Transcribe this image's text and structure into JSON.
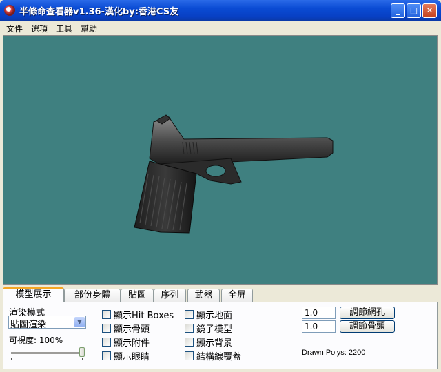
{
  "window": {
    "title": "半條命查看器v1.36-漢化by:香港CS友"
  },
  "menu": [
    "文件",
    "選項",
    "工具",
    "幫助"
  ],
  "tabs": [
    "模型展示",
    "部份身體",
    "貼圖",
    "序列",
    "武器",
    "全屏"
  ],
  "render_mode": {
    "label": "渲染模式",
    "value": "貼圖渲染"
  },
  "visibility": {
    "label": "可視度: 100%",
    "level_percent": 100
  },
  "checkboxes_col1": [
    "顯示Hit Boxes",
    "顯示骨頭",
    "顯示附件",
    "顯示眼睛"
  ],
  "checkboxes_col2": [
    "顯示地面",
    "鏡子模型",
    "顯示背景",
    "結構線覆蓋"
  ],
  "adjust": {
    "grid_value": "1.0",
    "grid_button": "調節網孔",
    "bone_value": "1.0",
    "bone_button": "調節骨頭"
  },
  "stats": {
    "drawn_polys": "Drawn Polys: 2200"
  },
  "colors": {
    "viewport_bg": "#3f8080",
    "titlebar": "#0a4bd4",
    "tab_highlight": "#f5a623"
  }
}
